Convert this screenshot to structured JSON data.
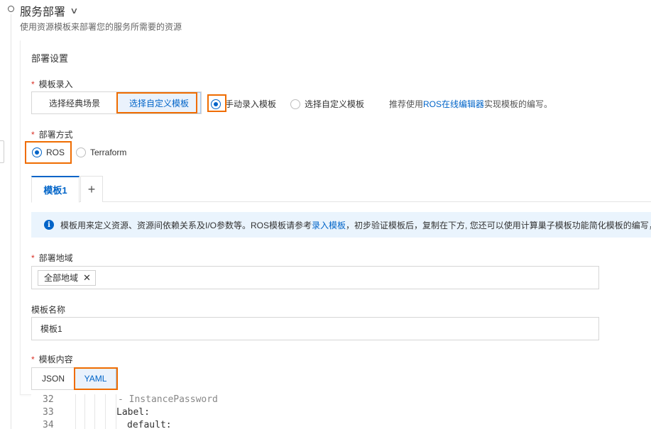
{
  "section": {
    "title": "服务部署",
    "description": "使用资源模板来部署您的服务所需要的资源"
  },
  "deploy_settings": {
    "title": "部署设置"
  },
  "template_entry": {
    "label": "模板录入",
    "segments": [
      {
        "label": "选择经典场景",
        "active": false
      },
      {
        "label": "选择自定义模板",
        "active": true
      }
    ],
    "radios": [
      {
        "label": "手动录入模板",
        "checked": true
      },
      {
        "label": "选择自定义模板",
        "checked": false
      }
    ],
    "hint_prefix": "推荐使用",
    "hint_link": "ROS在线编辑器",
    "hint_suffix": "实现模板的编写。"
  },
  "deploy_method": {
    "label": "部署方式",
    "options": [
      {
        "label": "ROS",
        "checked": true
      },
      {
        "label": "Terraform",
        "checked": false
      }
    ]
  },
  "tabs": {
    "items": [
      {
        "label": "模板1"
      }
    ],
    "add_icon": "plus-icon"
  },
  "info_banner": {
    "icon": "info-icon",
    "text_prefix": "模板用来定义资源、资源间依赖关系及I/O参数等。ROS模板请参考",
    "link": "录入模板",
    "text_suffix": "，初步验证模板后，复制在下方, 您还可以使用计算巢子模板功能简化模板的编写，"
  },
  "region": {
    "label": "部署地域",
    "tag": "全部地域",
    "remove_icon": "close-icon"
  },
  "template_name": {
    "label": "模板名称",
    "value": "模板1"
  },
  "template_content": {
    "label": "模板内容",
    "formats": [
      {
        "label": "JSON",
        "active": false
      },
      {
        "label": "YAML",
        "active": true
      }
    ]
  },
  "editor": {
    "lines": [
      {
        "num": "32",
        "text": "- InstancePassword"
      },
      {
        "num": "33",
        "text": "Label:"
      },
      {
        "num": "34",
        "text": "default:"
      }
    ]
  },
  "colors": {
    "accent": "#0064c8",
    "highlight": "#ef6c00",
    "required": "#d93026",
    "info_bg": "#eaf4fd"
  }
}
